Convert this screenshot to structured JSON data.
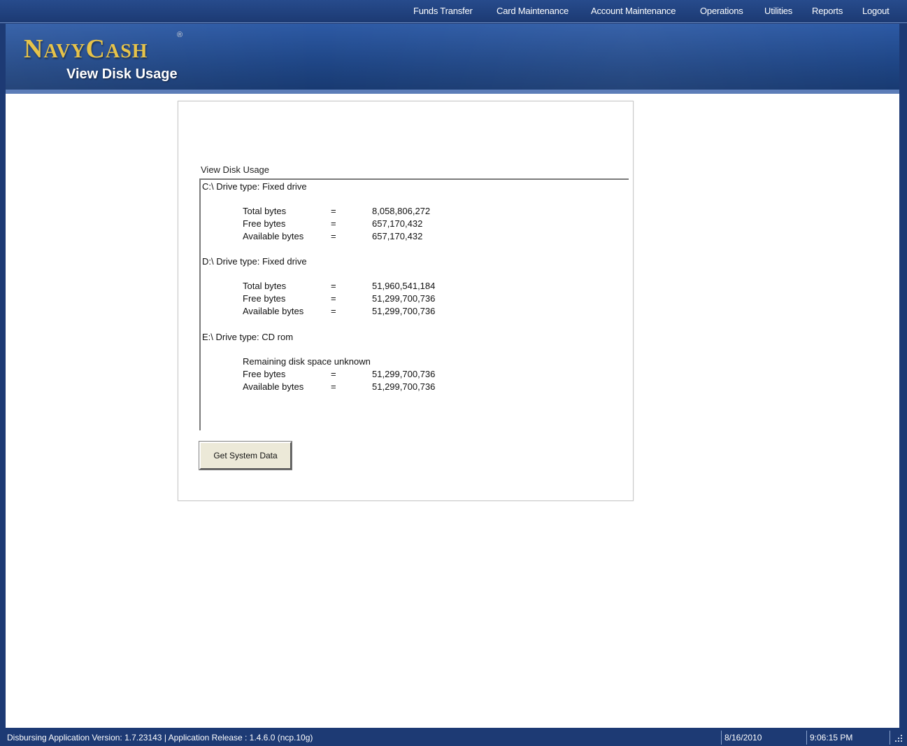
{
  "nav": {
    "items": [
      {
        "label": "Funds Transfer"
      },
      {
        "label": "Card Maintenance"
      },
      {
        "label": "Account Maintenance"
      },
      {
        "label": "Operations"
      },
      {
        "label": "Utilities"
      },
      {
        "label": "Reports"
      },
      {
        "label": "Logout"
      }
    ]
  },
  "banner": {
    "logo_first_letter": "N",
    "logo_rest_1": "AVY",
    "logo_second_letter": "C",
    "logo_rest_2": "ASH",
    "registered_mark": "®",
    "page_title": "View Disk Usage"
  },
  "panel": {
    "label": "View Disk Usage",
    "drives": [
      {
        "header": "C:\\ Drive type: Fixed drive",
        "rows": [
          {
            "key": "Total bytes",
            "eq": "=",
            "value": "8,058,806,272"
          },
          {
            "key": "Free bytes",
            "eq": "=",
            "value": "657,170,432"
          },
          {
            "key": "Available bytes",
            "eq": "=",
            "value": "657,170,432"
          }
        ]
      },
      {
        "header": "D:\\ Drive type: Fixed drive",
        "rows": [
          {
            "key": "Total bytes",
            "eq": "=",
            "value": "51,960,541,184"
          },
          {
            "key": "Free bytes",
            "eq": "=",
            "value": "51,299,700,736"
          },
          {
            "key": "Available bytes",
            "eq": "=",
            "value": "51,299,700,736"
          }
        ]
      },
      {
        "header": "E:\\ Drive type: CD rom",
        "note": "Remaining disk space unknown",
        "rows": [
          {
            "key": "Free bytes",
            "eq": "=",
            "value": "51,299,700,736"
          },
          {
            "key": "Available bytes",
            "eq": "=",
            "value": "51,299,700,736"
          }
        ]
      }
    ],
    "button_label": "Get System Data"
  },
  "status": {
    "version_text": "Disbursing Application Version:  1.7.23143  | Application Release : 1.4.6.0 (ncp.10g)",
    "date": "8/16/2010",
    "time": "9:06:15 PM"
  },
  "colors": {
    "frame_blue": "#1d3a74",
    "logo_gold": "#e6c34a",
    "button_face": "#ece9d8"
  }
}
